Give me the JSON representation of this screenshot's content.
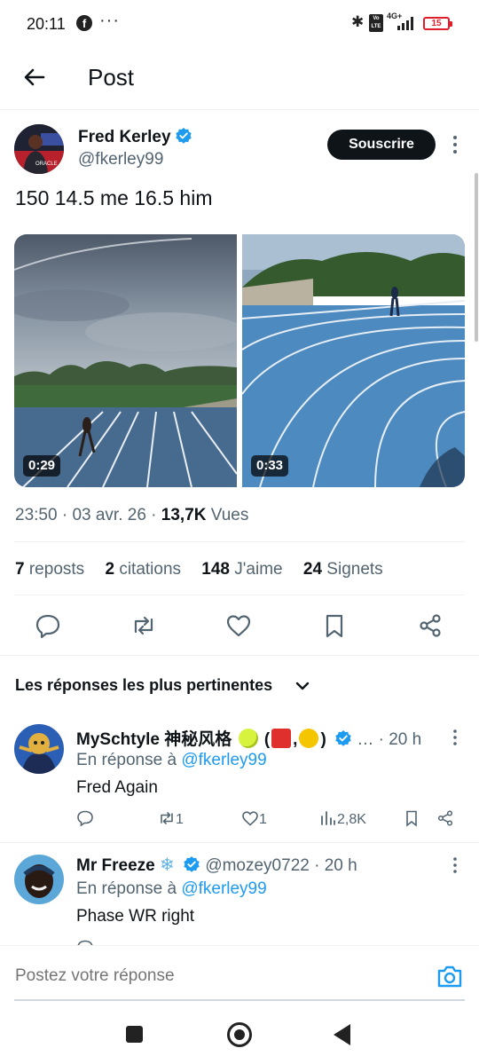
{
  "status_bar": {
    "time": "20:11",
    "notification_icons": [
      "facebook-icon",
      "more-dots-icon"
    ],
    "network": "4G+",
    "volte": "Vo LTE",
    "battery": "15",
    "battery_color": "#e01e2b"
  },
  "header": {
    "title": "Post",
    "back_icon": "arrow-left-icon"
  },
  "post": {
    "author_name": "Fred Kerley",
    "author_handle": "@fkerley99",
    "subscribe_label": "Souscrire",
    "text": "150 14.5 me 16.5 him",
    "media": [
      {
        "type": "video",
        "duration": "0:29"
      },
      {
        "type": "video",
        "duration": "0:33"
      }
    ],
    "time": "23:50",
    "date": "03 avr. 26",
    "views_count": "13,7K",
    "views_label": "Vues",
    "stats": {
      "reposts_count": "7",
      "reposts_label": "reposts",
      "quotes_count": "2",
      "quotes_label": "citations",
      "likes_count": "148",
      "likes_label": "J'aime",
      "bookmarks_count": "24",
      "bookmarks_label": "Signets"
    },
    "actions": [
      "reply-icon",
      "repost-icon",
      "like-icon",
      "bookmark-icon",
      "share-icon"
    ]
  },
  "replies_sort": {
    "label": "Les réponses les plus pertinentes"
  },
  "replies": [
    {
      "name": "MySchtyle 神秘风格",
      "name_suffix": "(",
      "name_sep": ",",
      "name_close": ")",
      "ellipsis": "…",
      "time": "· 20 h",
      "in_reply_label": "En réponse à",
      "in_reply_handle": "@fkerley99",
      "text": "Fred Again",
      "reposts": "1",
      "likes": "1",
      "views": "2,8K"
    },
    {
      "name": "Mr Freeze",
      "handle": "@mozey0722",
      "time": "· 20 h",
      "in_reply_label": "En réponse à",
      "in_reply_handle": "@fkerley99",
      "text": "Phase WR right"
    }
  ],
  "composer": {
    "placeholder": "Postez votre réponse"
  },
  "colors": {
    "accent": "#1d9bf0",
    "text": "#0f1419",
    "muted": "#536471",
    "divider": "#eff3f4"
  }
}
